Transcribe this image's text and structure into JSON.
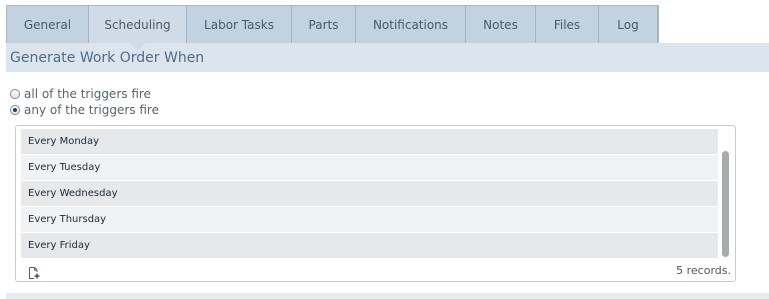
{
  "tabs": [
    {
      "label": "General"
    },
    {
      "label": "Scheduling"
    },
    {
      "label": "Labor Tasks"
    },
    {
      "label": "Parts"
    },
    {
      "label": "Notifications"
    },
    {
      "label": "Notes"
    },
    {
      "label": "Files"
    },
    {
      "label": "Log"
    }
  ],
  "active_tab": "Scheduling",
  "section": {
    "title": "Generate Work Order When"
  },
  "trigger_mode": {
    "options": [
      {
        "label": "all of the triggers fire",
        "selected": false
      },
      {
        "label": "any of the triggers fire",
        "selected": true
      }
    ]
  },
  "triggers": {
    "items": [
      {
        "label": "Every Monday"
      },
      {
        "label": "Every Tuesday"
      },
      {
        "label": "Every Wednesday"
      },
      {
        "label": "Every Thursday"
      },
      {
        "label": "Every Friday"
      }
    ],
    "record_count": "5 records."
  },
  "icons": {
    "add": "add-document-icon"
  },
  "colors": {
    "tab_bg": "#c2d2e0",
    "tab_active": "#cfdce7",
    "header_bg": "#dce5ee",
    "header_text": "#4f6c88"
  }
}
